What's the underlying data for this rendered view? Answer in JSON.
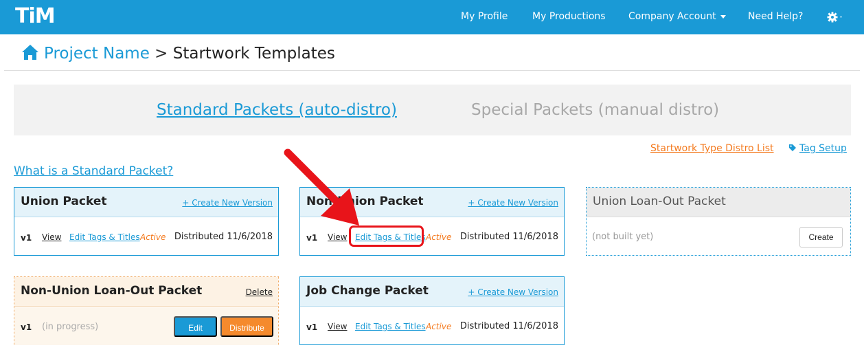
{
  "nav": {
    "logo": "TiM",
    "items": [
      {
        "label": "My Profile"
      },
      {
        "label": "My Productions"
      },
      {
        "label": "Company Account"
      },
      {
        "label": "Need Help?"
      }
    ],
    "settings_icon": "gear-icon"
  },
  "breadcrumb": {
    "home_icon": "home-icon",
    "project": "Project Name",
    "separator": ">",
    "current": "Startwork Templates"
  },
  "tabs": {
    "standard": "Standard Packets (auto-distro)",
    "special": "Special Packets (manual distro)"
  },
  "links": {
    "distro_list": "Startwork Type Distro List",
    "tag_setup": "Tag Setup",
    "what_is": "What is a Standard Packet?"
  },
  "cards": {
    "union": {
      "title": "Union Packet",
      "action": "+ Create New Version",
      "version": "v1",
      "view": "View",
      "edit_tags": "Edit Tags & Titles",
      "status": "Active",
      "distributed": "Distributed 11/6/2018"
    },
    "non_union": {
      "title": "Non-Union Packet",
      "action": "+ Create New Version",
      "version": "v1",
      "view": "View",
      "edit_tags": "Edit Tags & Titles",
      "status": "Active",
      "distributed": "Distributed 11/6/2018"
    },
    "union_loanout": {
      "title": "Union Loan-Out Packet",
      "status_text": "(not built yet)",
      "create": "Create"
    },
    "non_union_loanout": {
      "title": "Non-Union Loan-Out Packet",
      "delete": "Delete",
      "version": "v1",
      "status_text": "(in progress)",
      "edit": "Edit",
      "distribute": "Distribute"
    },
    "job_change": {
      "title": "Job Change Packet",
      "action": "+ Create New Version",
      "version": "v1",
      "view": "View",
      "edit_tags": "Edit Tags & Titles",
      "status": "Active",
      "distributed": "Distributed 11/6/2018"
    }
  },
  "colors": {
    "brand_blue": "#1a9ad6",
    "accent_orange": "#f47b20",
    "annotation_red": "#e8141a"
  }
}
